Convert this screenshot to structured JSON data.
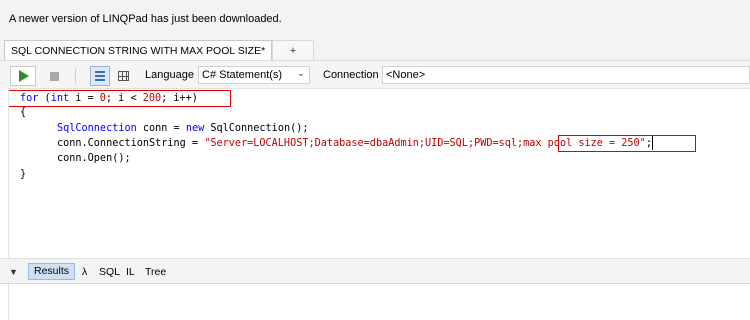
{
  "notification": {
    "text": "A newer version of LINQPad has just been downloaded."
  },
  "tabs": {
    "active": "SQL CONNECTION STRING WITH MAX POOL SIZE*",
    "add_label": "+"
  },
  "toolbar": {
    "run_icon": "play-icon",
    "stop_icon": "stop-icon",
    "view_rich_icon": "rich-text-results-icon",
    "view_grid_icon": "grid-results-icon",
    "language_label": "Language",
    "language_value": "C# Statement(s)",
    "connection_label": "Connection",
    "connection_value": "<None>"
  },
  "editor": {
    "lines": [
      {
        "for": "for",
        "open": " (",
        "int": "int",
        "mid1": " i = ",
        "zero": "0",
        "mid2": "; i < ",
        "n200": "200",
        "end": "; i++)"
      },
      {
        "text": "{"
      },
      {
        "type": "SqlConnection",
        "mid": " conn = ",
        "new": "new",
        "end": " SqlConnection();"
      },
      {
        "pre": "conn.ConnectionString = ",
        "str1": "\"Server=LOCALHOST;Database=dbaAdmin;UID=SQL;PWD=sql;",
        "str2": "max pool size = 250\"",
        "end": ";"
      },
      {
        "text": "conn.Open();"
      },
      {
        "text": "}"
      }
    ]
  },
  "results": {
    "collapse_icon": "triangle-down-icon",
    "tabs": [
      "Results",
      "λ",
      "SQL",
      "IL",
      "Tree"
    ]
  },
  "colors": {
    "keyword": "#0000ff",
    "string": "#c00000",
    "highlight_box": "#e00000",
    "run_green": "#2f8f2f"
  }
}
